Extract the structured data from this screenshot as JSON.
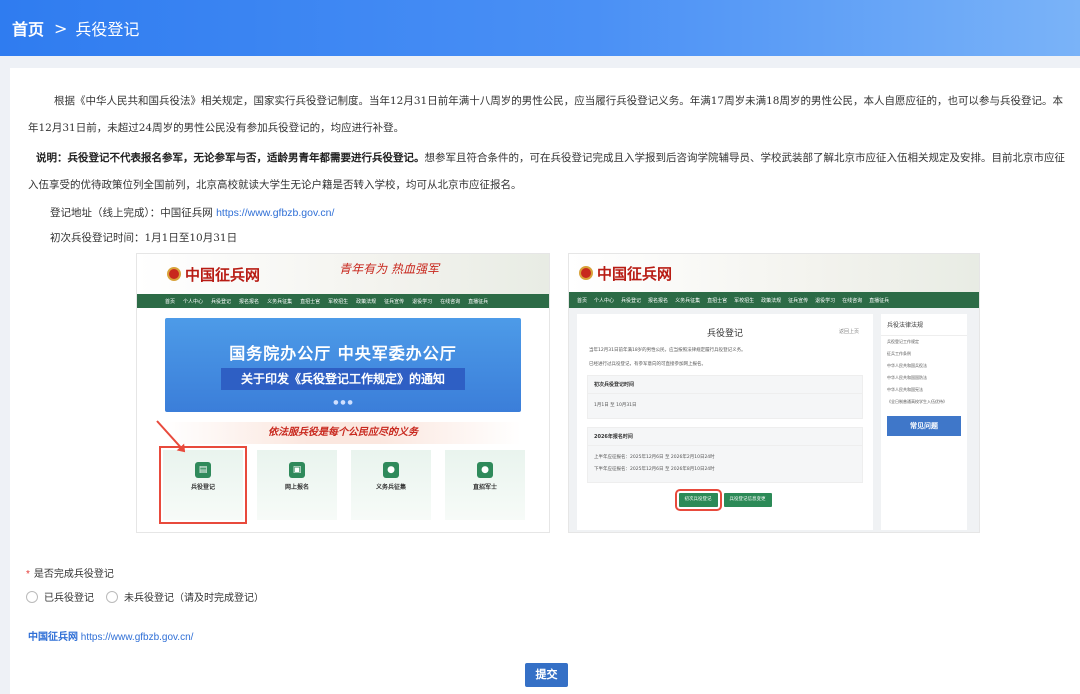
{
  "breadcrumb": {
    "home": "首页",
    "separator": ">",
    "current": "兵役登记"
  },
  "intro": {
    "p1": "根据《中华人民共和国兵役法》相关规定，国家实行兵役登记制度。当年12月31日前年满十八周岁的男性公民，应当履行兵役登记义务。年满17周岁未满18周岁的男性公民，本人自愿应征的，也可以参与兵役登记。本年12月31日前，未超过24周岁的男性公民没有参加兵役登记的，均应进行补登。",
    "note_bold": "说明：兵役登记不代表报名参军，无论参军与否，适龄男青年都需要进行兵役登记。",
    "note_rest": "想参军且符合条件的，可在兵役登记完成且入学报到后咨询学院辅导员、学校武装部了解北京市应征入伍相关规定及安排。目前北京市应征入伍享受的优待政策位列全国前列，北京高校就读大学生无论户籍是否转入学校，均可从北京市应征报名。",
    "addr_label": "登记地址（线上完成）：中国征兵网",
    "addr_url": "https://www.gfbzb.gov.cn/",
    "time": "初次兵役登记时间：1月1日至10月31日"
  },
  "shot1": {
    "logo": "中国征兵网",
    "slogan": "青年有为 热血强军",
    "banner_title": "国务院办公厅 中央军委办公厅",
    "banner_sub": "关于印发《兵役登记工作规定》的通知",
    "duty": "依法服兵役是每个公民应尽的义务",
    "nav": [
      "首页",
      "个人中心",
      "兵役登记",
      "报名报名",
      "义务兵征集",
      "直招士官",
      "军校招生",
      "政策法规",
      "征兵宣传",
      "退役学习",
      "在线咨询",
      "直播征兵"
    ],
    "tiles": [
      {
        "label": "兵役登记",
        "icon": "▤"
      },
      {
        "label": "网上报名",
        "icon": "▣"
      },
      {
        "label": "义务兵征集",
        "icon": "●"
      },
      {
        "label": "直招军士",
        "icon": "●"
      }
    ]
  },
  "shot2": {
    "logo": "中国征兵网",
    "title": "兵役登记",
    "back": "返回上页",
    "li1": "当年12月31日前年满18岁的男性公民，应当按照法律规定履行兵役登记义务。",
    "li2": "已经进行过兵役登记，有参军意向的可直接参加网上报名。",
    "box1_h": "初次兵役登记时间",
    "box1_b": "1月1日 至 10月31日",
    "box2_h": "2026年报名时间",
    "box2_b1": "上半年应征报名：2025年12月6日 至 2026年2月10日24时",
    "box2_b2": "下半年应征报名：2025年12月6日 至 2026年8月10日24时",
    "btn1": "初次兵役登记",
    "btn2": "兵役登记信息变更",
    "side_h": "兵役法律法规",
    "side_items": [
      "兵役登记工作规定",
      "征兵工作条例",
      "中华人民共和国兵役法",
      "中华人民共和国国防法",
      "中华人民共和国宪法",
      "《全日制普通高校学生入伍优待》"
    ],
    "faq": "常见问题"
  },
  "form": {
    "question": "是否完成兵役登记",
    "required_mark": "*",
    "opt1": "已兵役登记",
    "opt2": "未兵役登记（请及时完成登记）",
    "foot_name": "中国征兵网",
    "foot_url": "https://www.gfbzb.gov.cn/",
    "submit": "提交"
  },
  "colors": {
    "header": "#2f7cf0",
    "accent": "#3570c6",
    "link": "#2f6fd6",
    "required": "#e53935"
  }
}
